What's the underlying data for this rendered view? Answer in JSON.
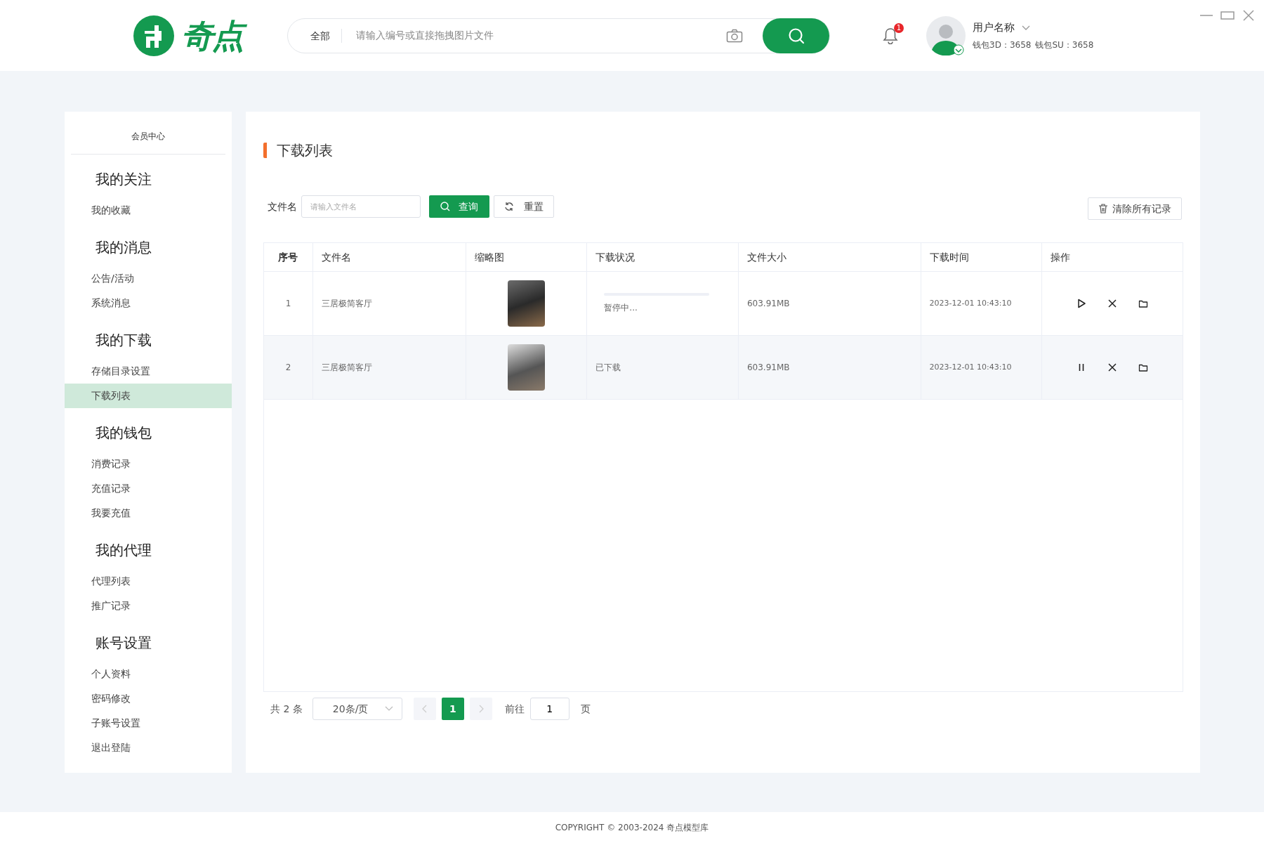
{
  "header": {
    "logo_text": "奇点",
    "search": {
      "scope": "全部",
      "placeholder": "请输入编号或直接拖拽图片文件"
    },
    "notification_count": "1",
    "user": {
      "name": "用户名称",
      "wallets": [
        "钱包3D：3658",
        "钱包SU：3658"
      ]
    }
  },
  "sidebar": {
    "title": "会员中心",
    "groups": [
      {
        "heading": "我的关注",
        "items": [
          {
            "label": "我的收藏",
            "selected": false
          }
        ]
      },
      {
        "heading": "我的消息",
        "items": [
          {
            "label": "公告/活动",
            "selected": false
          },
          {
            "label": "系统消息",
            "selected": false
          }
        ]
      },
      {
        "heading": "我的下载",
        "items": [
          {
            "label": "存储目录设置",
            "selected": false
          },
          {
            "label": "下载列表",
            "selected": true
          }
        ]
      },
      {
        "heading": "我的钱包",
        "items": [
          {
            "label": "消费记录",
            "selected": false
          },
          {
            "label": "充值记录",
            "selected": false
          },
          {
            "label": "我要充值",
            "selected": false
          }
        ]
      },
      {
        "heading": "我的代理",
        "items": [
          {
            "label": "代理列表",
            "selected": false
          },
          {
            "label": "推广记录",
            "selected": false
          }
        ]
      },
      {
        "heading": "账号设置",
        "items": [
          {
            "label": "个人资料",
            "selected": false
          },
          {
            "label": "密码修改",
            "selected": false
          },
          {
            "label": "子账号设置",
            "selected": false
          },
          {
            "label": "退出登陆",
            "selected": false
          }
        ]
      }
    ]
  },
  "page": {
    "title": "下载列表",
    "filter": {
      "label": "文件名",
      "placeholder": "请输入文件名",
      "search_button": "查询",
      "reset_button": "重置"
    },
    "clear_button": "清除所有记录"
  },
  "table": {
    "columns": [
      "序号",
      "文件名",
      "缩略图",
      "下载状况",
      "文件大小",
      "下载时间",
      "操作"
    ],
    "rows": [
      {
        "index": "1",
        "name": "三居极简客厅",
        "status": {
          "kind": "progress",
          "text": "暂停中...",
          "level": 0
        },
        "size": "603.91MB",
        "time": "2023-12-01 10:43:10",
        "paused": true
      },
      {
        "index": "2",
        "name": "三居极简客厅",
        "status": {
          "kind": "text",
          "text": "已下载"
        },
        "size": "603.91MB",
        "time": "2023-12-01 10:43:10",
        "paused": false
      }
    ]
  },
  "pagination": {
    "total": "共 2 条",
    "page_size": "20条/页",
    "pages": [
      {
        "label": "1",
        "selected": true
      }
    ],
    "goto_label": "前往",
    "goto_value": "1",
    "page_suffix": "页"
  },
  "footer": {
    "copyright": "COPYRIGHT © 2003-2024 奇点模型库"
  }
}
